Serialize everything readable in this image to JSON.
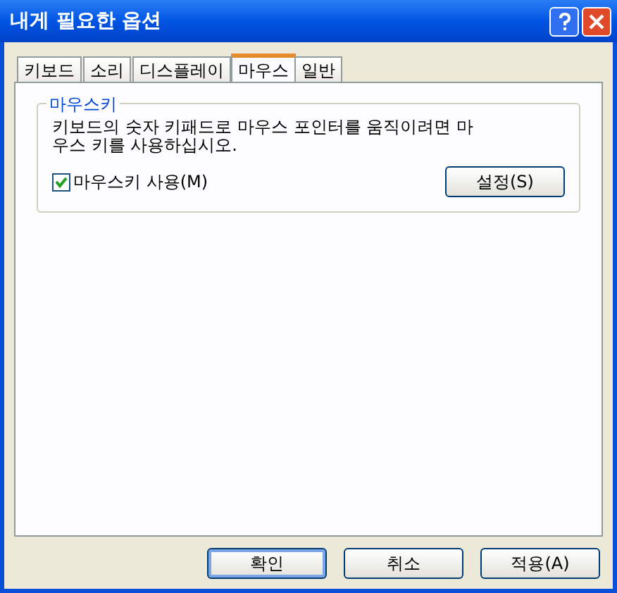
{
  "window": {
    "title": "내게 필요한 옵션"
  },
  "tabs": [
    {
      "label": "키보드",
      "selected": false
    },
    {
      "label": "소리",
      "selected": false
    },
    {
      "label": "디스플레이",
      "selected": false
    },
    {
      "label": "마우스",
      "selected": true
    },
    {
      "label": "일반",
      "selected": false
    }
  ],
  "group": {
    "title": "마우스키",
    "description": "키보드의 숫자 키패드로 마우스 포인터를 움직이려면 마우스 키를 사용하십시오.",
    "checkbox": {
      "label": "마우스키 사용(M)",
      "checked": true
    },
    "settings_button": "설정(S)"
  },
  "buttons": [
    {
      "label": "확인",
      "default": true
    },
    {
      "label": "취소",
      "default": false
    },
    {
      "label": "적용(A)",
      "default": false
    }
  ]
}
